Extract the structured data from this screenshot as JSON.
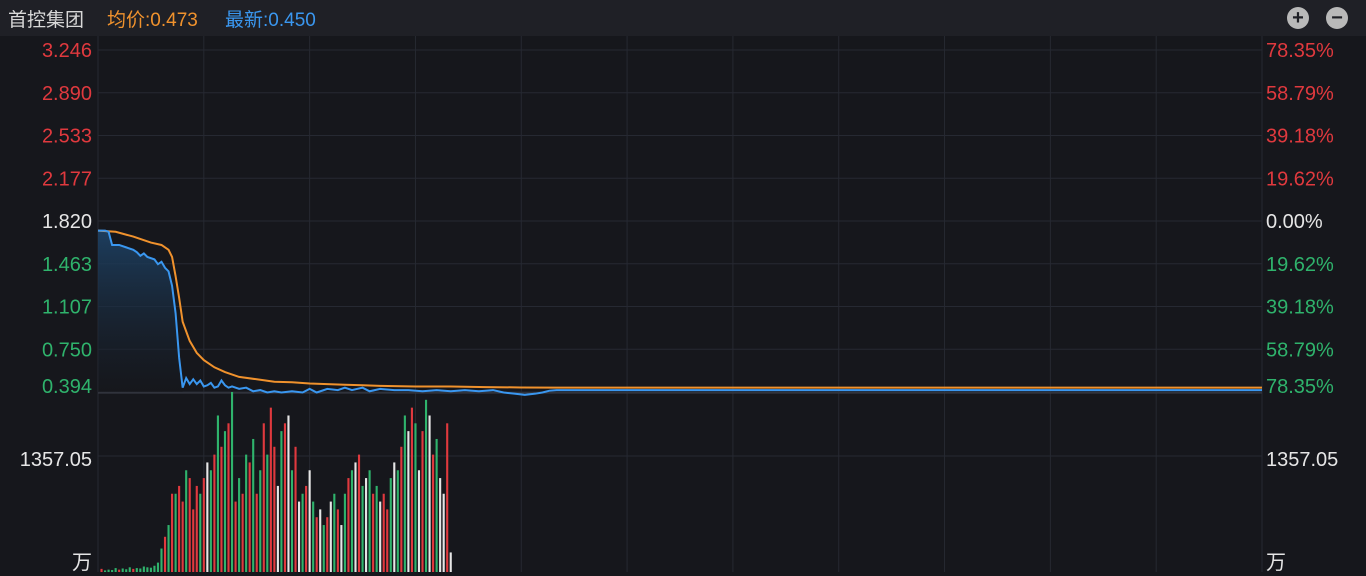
{
  "header": {
    "stock_name": "首控集团",
    "avg_label": "均价:0.473",
    "last_label": "最新:0.450",
    "zoom_in_icon": "plus-circle-icon",
    "zoom_out_icon": "minus-circle-icon"
  },
  "colors": {
    "background": "#16171c",
    "header_bg": "#1f2026",
    "grid": "#262932",
    "up": "#e0393e",
    "down": "#2fb36c",
    "neutral": "#e6e6e6",
    "price_line": "#3a97f0",
    "avg_line": "#f0922d"
  },
  "chart_data": {
    "type": "line",
    "prev_close": 1.82,
    "price_axis": {
      "ticks": [
        3.246,
        2.89,
        2.533,
        2.177,
        1.82,
        1.463,
        1.107,
        0.75,
        0.394
      ],
      "labels": [
        "3.246",
        "2.890",
        "2.533",
        "2.177",
        "1.820",
        "1.463",
        "1.107",
        "0.750",
        "0.394"
      ],
      "ylim": [
        0.394,
        3.246
      ]
    },
    "pct_axis": {
      "labels": [
        "78.35%",
        "58.79%",
        "39.18%",
        "19.62%",
        "0.00%",
        "19.62%",
        "39.18%",
        "58.79%",
        "78.35%"
      ]
    },
    "volume_axis": {
      "max_label": "1357.05",
      "unit": "万",
      "ylim": [
        0,
        2300
      ]
    },
    "total_minutes": 330,
    "series": [
      {
        "key": "price",
        "points": [
          [
            0,
            1.74
          ],
          [
            2,
            1.74
          ],
          [
            3,
            1.73
          ],
          [
            4,
            1.62
          ],
          [
            6,
            1.62
          ],
          [
            8,
            1.6
          ],
          [
            10,
            1.58
          ],
          [
            11,
            1.56
          ],
          [
            12,
            1.53
          ],
          [
            13,
            1.55
          ],
          [
            14,
            1.52
          ],
          [
            16,
            1.5
          ],
          [
            17,
            1.46
          ],
          [
            18,
            1.48
          ],
          [
            19,
            1.43
          ],
          [
            20,
            1.4
          ],
          [
            21,
            1.28
          ],
          [
            22,
            1.05
          ],
          [
            23,
            0.68
          ],
          [
            24,
            0.43
          ],
          [
            25,
            0.51
          ],
          [
            26,
            0.46
          ],
          [
            27,
            0.5
          ],
          [
            28,
            0.46
          ],
          [
            29,
            0.49
          ],
          [
            30,
            0.44
          ],
          [
            31,
            0.45
          ],
          [
            32,
            0.47
          ],
          [
            33,
            0.43
          ],
          [
            34,
            0.44
          ],
          [
            35,
            0.49
          ],
          [
            36,
            0.45
          ],
          [
            37,
            0.43
          ],
          [
            38,
            0.44
          ],
          [
            40,
            0.42
          ],
          [
            42,
            0.43
          ],
          [
            44,
            0.4
          ],
          [
            46,
            0.41
          ],
          [
            48,
            0.39
          ],
          [
            50,
            0.4
          ],
          [
            52,
            0.39
          ],
          [
            55,
            0.4
          ],
          [
            58,
            0.39
          ],
          [
            60,
            0.42
          ],
          [
            62,
            0.39
          ],
          [
            65,
            0.42
          ],
          [
            68,
            0.41
          ],
          [
            70,
            0.43
          ],
          [
            72,
            0.41
          ],
          [
            75,
            0.43
          ],
          [
            77,
            0.4
          ],
          [
            80,
            0.42
          ],
          [
            84,
            0.41
          ],
          [
            88,
            0.41
          ],
          [
            92,
            0.4
          ],
          [
            96,
            0.41
          ],
          [
            100,
            0.4
          ],
          [
            104,
            0.41
          ],
          [
            108,
            0.4
          ],
          [
            112,
            0.41
          ],
          [
            115,
            0.39
          ],
          [
            118,
            0.38
          ],
          [
            121,
            0.37
          ],
          [
            124,
            0.38
          ],
          [
            126,
            0.39
          ],
          [
            128,
            0.405
          ],
          [
            130,
            0.41
          ],
          [
            330,
            0.41
          ]
        ]
      },
      {
        "key": "avg",
        "points": [
          [
            0,
            1.74
          ],
          [
            5,
            1.73
          ],
          [
            10,
            1.69
          ],
          [
            15,
            1.64
          ],
          [
            18,
            1.62
          ],
          [
            20,
            1.58
          ],
          [
            21,
            1.52
          ],
          [
            22,
            1.36
          ],
          [
            23,
            1.18
          ],
          [
            24,
            0.98
          ],
          [
            26,
            0.82
          ],
          [
            28,
            0.72
          ],
          [
            30,
            0.66
          ],
          [
            33,
            0.6
          ],
          [
            36,
            0.56
          ],
          [
            40,
            0.52
          ],
          [
            45,
            0.5
          ],
          [
            50,
            0.48
          ],
          [
            55,
            0.475
          ],
          [
            60,
            0.465
          ],
          [
            65,
            0.46
          ],
          [
            70,
            0.455
          ],
          [
            75,
            0.45
          ],
          [
            80,
            0.445
          ],
          [
            90,
            0.44
          ],
          [
            100,
            0.44
          ],
          [
            110,
            0.435
          ],
          [
            120,
            0.432
          ],
          [
            130,
            0.43
          ],
          [
            330,
            0.43
          ]
        ]
      }
    ],
    "volume": {
      "start_minute": 1,
      "values": [
        40,
        20,
        30,
        25,
        50,
        30,
        45,
        35,
        60,
        40,
        50,
        45,
        70,
        60,
        55,
        80,
        120,
        300,
        450,
        600,
        1000,
        1000,
        1100,
        900,
        1300,
        1200,
        800,
        1100,
        1000,
        1200,
        1400,
        1300,
        1500,
        2000,
        1600,
        1800,
        1900,
        2300,
        900,
        1200,
        1000,
        1500,
        1400,
        1700,
        1000,
        1300,
        1900,
        1500,
        2100,
        1600,
        1100,
        1800,
        1900,
        2000,
        1300,
        1600,
        900,
        1000,
        1100,
        1300,
        900,
        700,
        800,
        600,
        700,
        900,
        1000,
        800,
        600,
        1000,
        1200,
        1300,
        1400,
        1500,
        1100,
        1200,
        1300,
        1000,
        1100,
        900,
        1000,
        800,
        1200,
        1400,
        1300,
        1600,
        2000,
        1800,
        2100,
        1900,
        1300,
        1800,
        2200,
        2000,
        1500,
        1700,
        1200,
        1000,
        1900,
        250
      ],
      "colors": [
        "up",
        "down",
        "down",
        "down",
        "down",
        "up",
        "down",
        "down",
        "down",
        "up",
        "down",
        "down",
        "down",
        "down",
        "down",
        "down",
        "down",
        "down",
        "up",
        "down",
        "up",
        "down",
        "up",
        "up",
        "down",
        "up",
        "up",
        "up",
        "down",
        "up",
        "neutral",
        "down",
        "up",
        "down",
        "up",
        "down",
        "up",
        "down",
        "up",
        "down",
        "up",
        "down",
        "up",
        "down",
        "up",
        "down",
        "up",
        "down",
        "up",
        "up",
        "neutral",
        "down",
        "up",
        "neutral",
        "down",
        "up",
        "neutral",
        "down",
        "up",
        "neutral",
        "down",
        "up",
        "neutral",
        "down",
        "up",
        "neutral",
        "down",
        "up",
        "neutral",
        "down",
        "up",
        "down",
        "neutral",
        "up",
        "down",
        "neutral",
        "down",
        "up",
        "down",
        "neutral",
        "up",
        "up",
        "down",
        "neutral",
        "down",
        "up",
        "down",
        "neutral",
        "up",
        "down",
        "neutral",
        "up",
        "down",
        "neutral",
        "up",
        "down",
        "neutral",
        "neutral",
        "up",
        "neutral"
      ]
    }
  }
}
